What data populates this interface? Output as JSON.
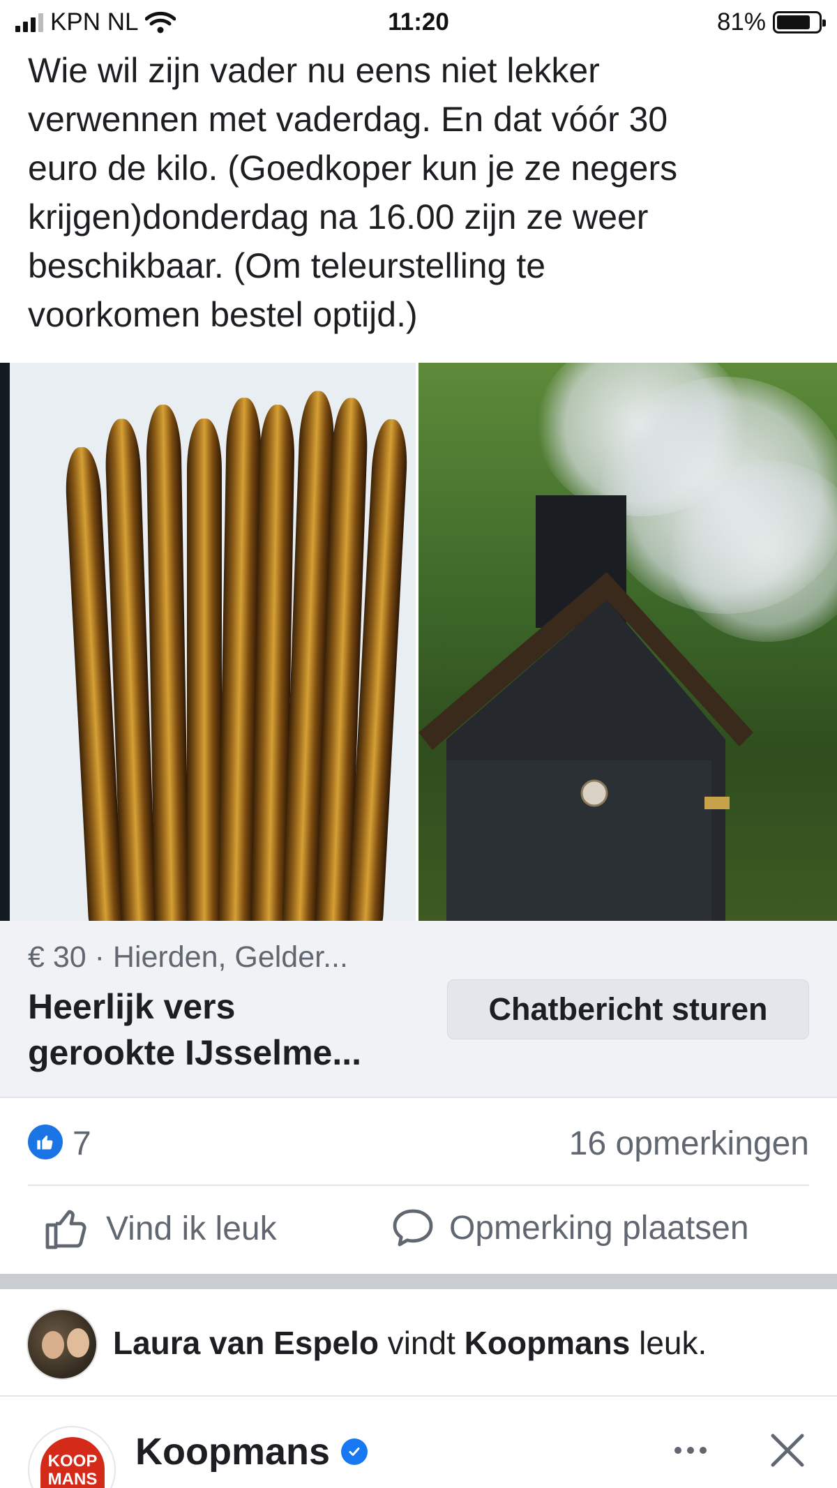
{
  "status_bar": {
    "carrier": "KPN NL",
    "time": "11:20",
    "battery": "81%",
    "battery_level": 0.81
  },
  "post": {
    "text": "Wie wil zijn vader nu eens niet lekker\nverwennen met vaderdag. En dat vóór 30\neuro de kilo. (Goedkoper kun je ze negers\nkrijgen)donderdag na 16.00 zijn ze weer\nbeschikbaar. (Om teleurstelling te\nvoorkomen bestel optijd.)"
  },
  "listing": {
    "meta": "€ 30 · Hierden, Gelder...",
    "title": "Heerlijk vers\ngerookte IJsselme...",
    "chat_button": "Chatbericht sturen"
  },
  "reactions": {
    "likes": "7",
    "comments": "16 opmerkingen"
  },
  "actions": {
    "like": "Vind ik leuk",
    "comment": "Opmerking plaatsen"
  },
  "activity": {
    "person": "Laura van Espelo",
    "verb": " vindt ",
    "page": "Koopmans",
    "suffix": " leuk."
  },
  "next_post": {
    "page_name": "Koopmans",
    "logo_text": "KOOP\nMANS"
  },
  "colors": {
    "facebook_blue": "#1877f2",
    "secondary_text": "#606770",
    "listing_bg": "#f0f2f5",
    "band": "#c9ccd1",
    "brand_red": "#d42a1a"
  },
  "icons": [
    "signal-icon",
    "wifi-icon",
    "battery-icon",
    "like-badge-icon",
    "thumbs-up-icon",
    "comment-icon",
    "verified-icon",
    "more-icon",
    "close-icon"
  ]
}
